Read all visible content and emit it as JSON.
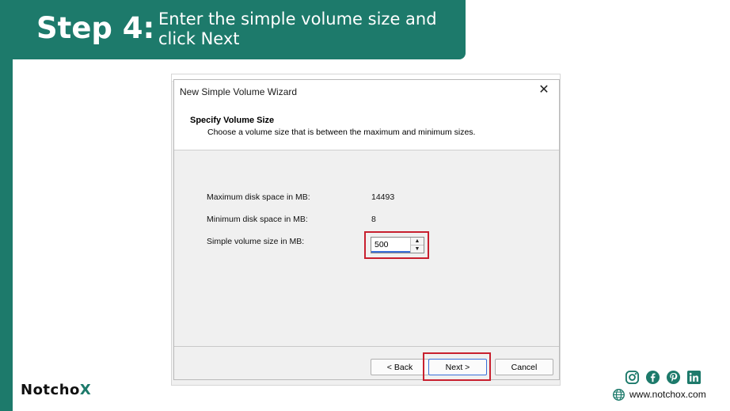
{
  "banner": {
    "step": "Step 4:",
    "description": "Enter the simple volume size and click Next"
  },
  "dialog": {
    "title": "New Simple Volume Wizard",
    "close_icon": "close-icon",
    "heading": "Specify Volume Size",
    "subheading": "Choose a volume size that is between the maximum and minimum sizes.",
    "rows": [
      {
        "label": "Maximum disk space in MB:",
        "value": "14493"
      },
      {
        "label": "Minimum disk space in MB:",
        "value": "8"
      },
      {
        "label": "Simple volume size in MB:",
        "value": "500"
      }
    ],
    "buttons": {
      "back": "< Back",
      "next": "Next >",
      "cancel": "Cancel"
    }
  },
  "footer": {
    "brand_main": "Notcho",
    "brand_x": "X",
    "website": "www.notchox.com",
    "social_icons": [
      "instagram-icon",
      "facebook-icon",
      "pinterest-icon",
      "linkedin-icon"
    ],
    "brand_color": "#1d7a6b",
    "highlight_color": "#c8202f"
  }
}
